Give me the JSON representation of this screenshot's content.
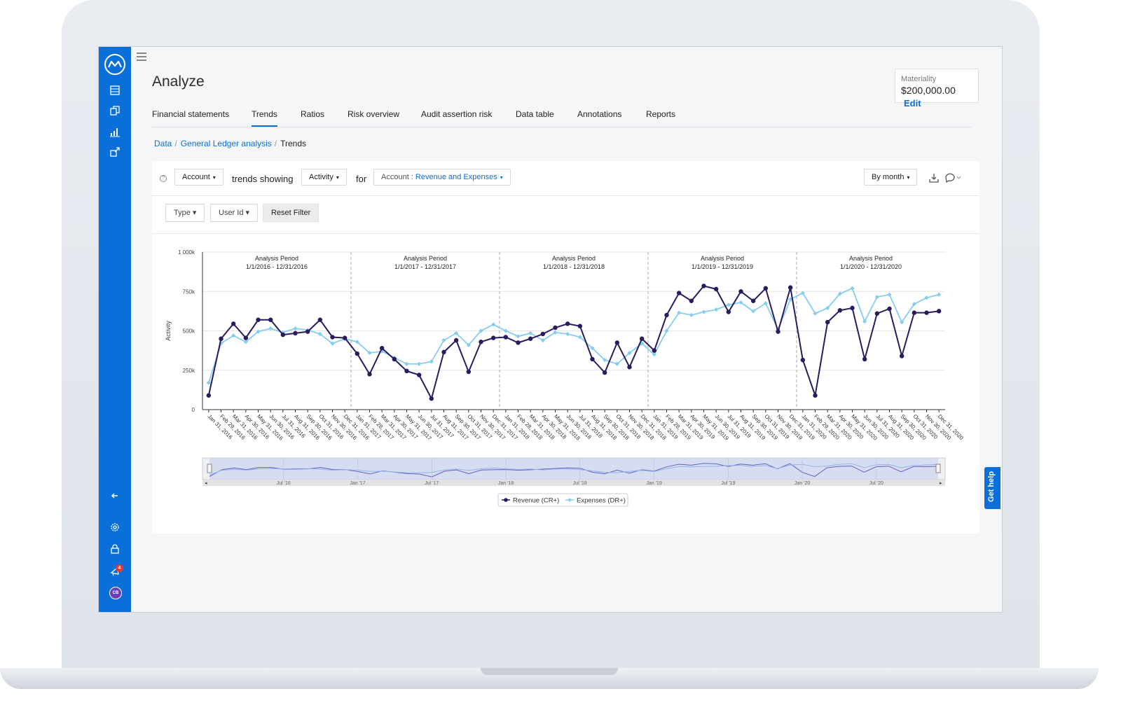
{
  "app": {
    "page_title": "Analyze",
    "materiality": {
      "label": "Materiality",
      "value": "$200,000.00",
      "edit_label": "Edit"
    },
    "tabs": [
      {
        "label": "Financial statements"
      },
      {
        "label": "Trends",
        "active": true
      },
      {
        "label": "Ratios"
      },
      {
        "label": "Risk overview"
      },
      {
        "label": "Audit assertion risk"
      },
      {
        "label": "Data table"
      },
      {
        "label": "Annotations"
      },
      {
        "label": "Reports"
      }
    ],
    "breadcrumb": [
      {
        "label": "Data"
      },
      {
        "label": "General Ledger analysis"
      },
      {
        "label": "Trends"
      }
    ],
    "toolbar": {
      "help_icon": "?",
      "dimension": "Account",
      "text_trends_showing": "trends showing",
      "measure": "Activity",
      "text_for": "for",
      "filter_prefix": "Account : ",
      "filter_value": "Revenue and Expenses",
      "period": "By month"
    },
    "filters": {
      "type_label": "Type",
      "user_label": "User Id",
      "reset_label": "Reset Filter"
    },
    "sidebar": {
      "icons": [
        "logo-icon",
        "table-icon",
        "documents-icon",
        "bar-chart-icon",
        "export-icon",
        "collapse-arrow-icon",
        "settings-icon",
        "lock-icon",
        "announcement-icon",
        "avatar"
      ],
      "notification_count": "4",
      "user_initials": "CB"
    },
    "get_help": "Get help",
    "colors": {
      "brand": "#0a6fd8",
      "revenue": "#2b1a5e",
      "expenses": "#87cdee"
    }
  },
  "chart_data": {
    "type": "line",
    "ylabel": "Activity",
    "ylim": [
      0,
      1000000
    ],
    "y_ticks": [
      "0",
      "250k",
      "500k",
      "750k",
      "1 000k"
    ],
    "x": [
      "Jan 31, 2016",
      "Feb 29, 2016",
      "Mar 31, 2016",
      "Apr 30, 2016",
      "May 31, 2016",
      "Jun 30, 2016",
      "Jul 31, 2016",
      "Aug 31, 2016",
      "Sep 30, 2016",
      "Oct 31, 2016",
      "Nov 30, 2016",
      "Dec 31, 2016",
      "Jan 31, 2017",
      "Feb 28, 2017",
      "Mar 31, 2017",
      "Apr 30, 2017",
      "May 31, 2017",
      "Jun 30, 2017",
      "Jul 31, 2017",
      "Aug 31, 2017",
      "Sep 30, 2017",
      "Oct 31, 2017",
      "Nov 30, 2017",
      "Dec 31, 2017",
      "Jan 31, 2018",
      "Feb 28, 2018",
      "Mar 31, 2018",
      "Apr 30, 2018",
      "May 31, 2018",
      "Jun 30, 2018",
      "Jul 31, 2018",
      "Aug 31, 2018",
      "Sep 30, 2018",
      "Oct 31, 2018",
      "Nov 30, 2018",
      "Dec 31, 2018",
      "Jan 31, 2019",
      "Feb 28, 2019",
      "Mar 31, 2019",
      "Apr 30, 2019",
      "May 31, 2019",
      "Jun 30, 2019",
      "Jul 31, 2019",
      "Aug 31, 2019",
      "Sep 30, 2019",
      "Oct 31, 2019",
      "Nov 30, 2019",
      "Dec 31, 2019",
      "Jan 31, 2020",
      "Feb 29, 2020",
      "Mar 31, 2020",
      "Apr 30, 2020",
      "May 31, 2020",
      "Jun 30, 2020",
      "Jul 31, 2020",
      "Aug 31, 2020",
      "Sep 30, 2020",
      "Oct 31, 2020",
      "Nov 30, 2020",
      "Dec 31, 2020"
    ],
    "series": [
      {
        "name": "Revenue (CR+)",
        "color": "#2b1a5e",
        "values": [
          90000,
          450000,
          545000,
          455000,
          570000,
          570000,
          475000,
          485000,
          495000,
          570000,
          460000,
          455000,
          355000,
          225000,
          390000,
          320000,
          245000,
          220000,
          70000,
          365000,
          440000,
          240000,
          430000,
          455000,
          460000,
          425000,
          450000,
          480000,
          520000,
          545000,
          530000,
          320000,
          235000,
          425000,
          270000,
          450000,
          375000,
          600000,
          740000,
          690000,
          785000,
          765000,
          620000,
          750000,
          690000,
          770000,
          495000,
          775000,
          315000,
          90000,
          555000,
          630000,
          645000,
          320000,
          610000,
          640000,
          340000,
          615000,
          615000,
          625000
        ]
      },
      {
        "name": "Expenses (DR+)",
        "color": "#87cdee",
        "values": [
          170000,
          420000,
          470000,
          430000,
          495000,
          515000,
          490000,
          515000,
          505000,
          480000,
          420000,
          450000,
          430000,
          360000,
          370000,
          330000,
          290000,
          290000,
          305000,
          440000,
          485000,
          410000,
          500000,
          540000,
          500000,
          465000,
          485000,
          440000,
          490000,
          480000,
          460000,
          390000,
          315000,
          290000,
          360000,
          420000,
          350000,
          500000,
          615000,
          600000,
          620000,
          635000,
          665000,
          680000,
          625000,
          675000,
          510000,
          700000,
          740000,
          610000,
          645000,
          735000,
          770000,
          560000,
          715000,
          730000,
          555000,
          670000,
          710000,
          730000
        ]
      }
    ],
    "annotations": [
      {
        "title": "Analysis Period",
        "range": "1/1/2016 - 12/31/2016"
      },
      {
        "title": "Analysis Period",
        "range": "1/1/2017 - 12/31/2017"
      },
      {
        "title": "Analysis Period",
        "range": "1/1/2018 - 12/31/2018"
      },
      {
        "title": "Analysis Period",
        "range": "1/1/2019 - 12/31/2019"
      },
      {
        "title": "Analysis Period",
        "range": "1/1/2020 - 12/31/2020"
      }
    ],
    "navigator_labels": [
      "Jul '16",
      "Jan '17",
      "Jul '17",
      "Jan '18",
      "Jul '18",
      "Jan '19",
      "Jul '19",
      "Jan '20",
      "Jul '20"
    ],
    "legend": [
      "Revenue (CR+)",
      "Expenses (DR+)"
    ],
    "grid": true,
    "legend_position": "bottom"
  }
}
